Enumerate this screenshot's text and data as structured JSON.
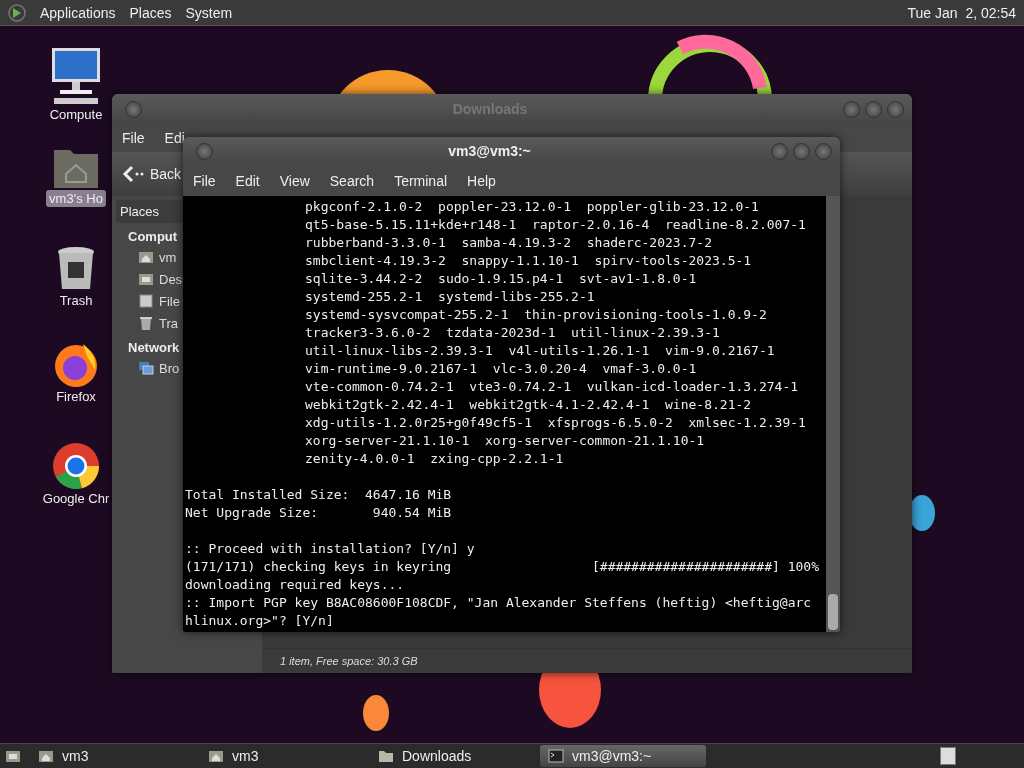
{
  "top_panel": {
    "menus": [
      "Applications",
      "Places",
      "System"
    ],
    "clock": "Tue Jan  2, 02:54"
  },
  "desktop_icons": [
    {
      "label": "Compute",
      "kind": "computer",
      "selected": false
    },
    {
      "label": "vm3's Ho",
      "kind": "home",
      "selected": true
    },
    {
      "label": "Trash",
      "kind": "trash",
      "selected": false
    },
    {
      "label": "Firefox",
      "kind": "firefox",
      "selected": false
    },
    {
      "label": "Google Chr",
      "kind": "chrome",
      "selected": false
    }
  ],
  "file_manager": {
    "title": "Downloads",
    "menu": [
      "File",
      "Edi"
    ],
    "back": "Back",
    "sidebar_header": "Places",
    "sections": [
      {
        "heading": "Comput",
        "items": [
          {
            "label": "vm",
            "kind": "home"
          },
          {
            "label": "Des",
            "kind": "desktop"
          },
          {
            "label": "File",
            "kind": "drive"
          },
          {
            "label": "Tra",
            "kind": "trash"
          }
        ]
      },
      {
        "heading": "Network",
        "items": [
          {
            "label": "Bro",
            "kind": "network"
          }
        ]
      }
    ],
    "status": "1 item, Free space: 30.3 GB"
  },
  "terminal": {
    "title": "vm3@vm3:~",
    "menu": [
      "File",
      "Edit",
      "View",
      "Search",
      "Terminal",
      "Help"
    ],
    "lines": [
      {
        "kind": "package",
        "text": "pkgconf-2.1.0-2  poppler-23.12.0-1  poppler-glib-23.12.0-1"
      },
      {
        "kind": "package",
        "text": "qt5-base-5.15.11+kde+r148-1  raptor-2.0.16-4  readline-8.2.007-1"
      },
      {
        "kind": "package",
        "text": "rubberband-3.3.0-1  samba-4.19.3-2  shaderc-2023.7-2"
      },
      {
        "kind": "package",
        "text": "smbclient-4.19.3-2  snappy-1.1.10-1  spirv-tools-2023.5-1"
      },
      {
        "kind": "package",
        "text": "sqlite-3.44.2-2  sudo-1.9.15.p4-1  svt-av1-1.8.0-1"
      },
      {
        "kind": "package",
        "text": "systemd-255.2-1  systemd-libs-255.2-1"
      },
      {
        "kind": "package",
        "text": "systemd-sysvcompat-255.2-1  thin-provisioning-tools-1.0.9-2"
      },
      {
        "kind": "package",
        "text": "tracker3-3.6.0-2  tzdata-2023d-1  util-linux-2.39.3-1"
      },
      {
        "kind": "package",
        "text": "util-linux-libs-2.39.3-1  v4l-utils-1.26.1-1  vim-9.0.2167-1"
      },
      {
        "kind": "package",
        "text": "vim-runtime-9.0.2167-1  vlc-3.0.20-4  vmaf-3.0.0-1"
      },
      {
        "kind": "package",
        "text": "vte-common-0.74.2-1  vte3-0.74.2-1  vulkan-icd-loader-1.3.274-1"
      },
      {
        "kind": "package",
        "text": "webkit2gtk-2.42.4-1  webkit2gtk-4.1-2.42.4-1  wine-8.21-2"
      },
      {
        "kind": "package",
        "text": "xdg-utils-1.2.0r25+g0f49cf5-1  xfsprogs-6.5.0-2  xmlsec-1.2.39-1"
      },
      {
        "kind": "package",
        "text": "xorg-server-21.1.10-1  xorg-server-common-21.1.10-1"
      },
      {
        "kind": "package",
        "text": "zenity-4.0.0-1  zxing-cpp-2.2.1-1"
      },
      {
        "kind": "blank"
      },
      {
        "kind": "plain",
        "text": "Total Installed Size:  4647.16 MiB"
      },
      {
        "kind": "plain",
        "text": "Net Upgrade Size:       940.54 MiB"
      },
      {
        "kind": "blank"
      },
      {
        "kind": "plain",
        "text": ":: Proceed with installation? [Y/n] y"
      },
      {
        "kind": "plain",
        "text": "(171/171) checking keys in keyring                  [######################] 100%"
      },
      {
        "kind": "plain",
        "text": "downloading required keys..."
      },
      {
        "kind": "plain",
        "text": ":: Import PGP key B8AC08600F108CDF, \"Jan Alexander Steffens (heftig) <heftig@arc"
      },
      {
        "kind": "plain",
        "text": "hlinux.org>\"? [Y/n]"
      }
    ]
  },
  "taskbar": {
    "tasks": [
      {
        "label": "vm3",
        "kind": "home",
        "selected": false
      },
      {
        "label": "vm3",
        "kind": "home",
        "selected": false
      },
      {
        "label": "Downloads",
        "kind": "folder",
        "selected": false
      },
      {
        "label": "vm3@vm3:~",
        "kind": "terminal",
        "selected": true
      }
    ]
  }
}
